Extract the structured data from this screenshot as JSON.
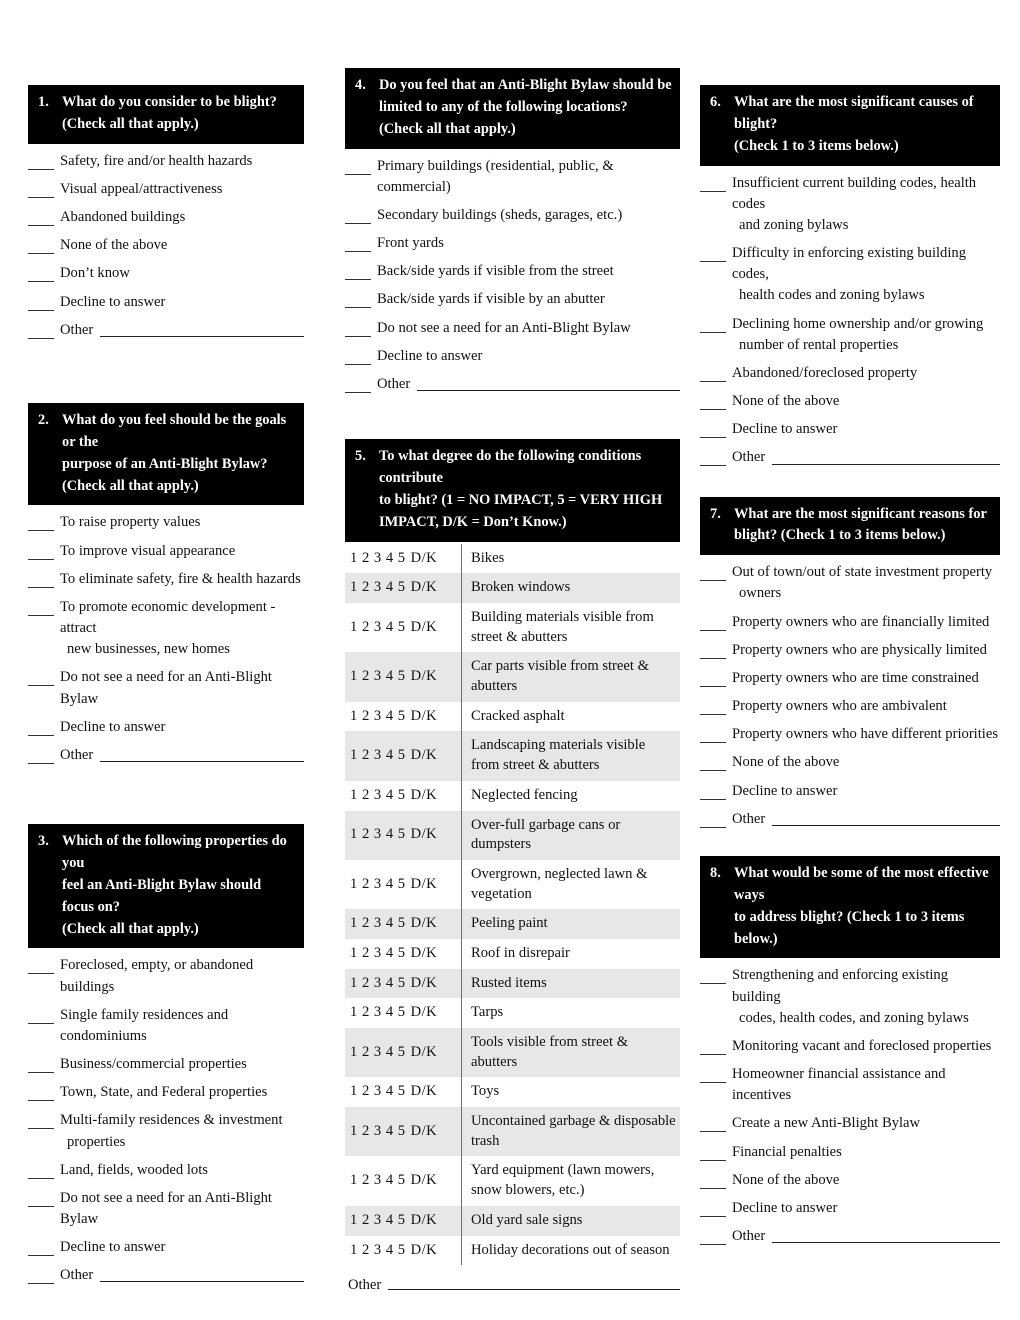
{
  "document": {
    "type": "survey-questionnaire",
    "colors": {
      "header_bar": "#000000",
      "header_text": "#ffffff",
      "row_shade": "#e7e7e7",
      "page": "#ffffff"
    }
  },
  "columns": {
    "left": [
      "q1",
      "q2",
      "q3"
    ],
    "middle": [
      "q4",
      "q5"
    ],
    "right": [
      "q6",
      "q7",
      "q8"
    ]
  },
  "questions": {
    "q1": {
      "number": "1.",
      "header_lines": [
        "What do you consider to be blight?",
        "(Check all that apply.)"
      ],
      "options": [
        {
          "lines": [
            "Safety, fire and/or health hazards"
          ]
        },
        {
          "lines": [
            "Visual appeal/attractiveness"
          ]
        },
        {
          "lines": [
            "Abandoned buildings"
          ]
        },
        {
          "lines": [
            "None of the above"
          ]
        },
        {
          "lines": [
            "Don’t know"
          ]
        },
        {
          "lines": [
            "Decline to answer"
          ]
        },
        {
          "lines": [
            "Other"
          ],
          "rule": true
        }
      ]
    },
    "q2": {
      "number": "2.",
      "header_lines": [
        "What do you feel should be the goals or the",
        "purpose of an Anti-Blight Bylaw?",
        "(Check all that apply.)"
      ],
      "options": [
        {
          "lines": [
            "To raise property values"
          ]
        },
        {
          "lines": [
            "To improve visual appearance"
          ]
        },
        {
          "lines": [
            "To eliminate safety, fire & health hazards"
          ]
        },
        {
          "lines": [
            "To promote economic development - attract",
            "new businesses, new homes"
          ]
        },
        {
          "lines": [
            "Do not see a need for an Anti-Blight Bylaw"
          ]
        },
        {
          "lines": [
            "Decline to answer"
          ]
        },
        {
          "lines": [
            "Other"
          ],
          "rule": true
        }
      ]
    },
    "q3": {
      "number": "3.",
      "header_lines": [
        "Which of the following properties do you",
        "feel an Anti-Blight Bylaw should focus on?",
        "(Check all that apply.)"
      ],
      "options": [
        {
          "lines": [
            "Foreclosed, empty, or abandoned buildings"
          ]
        },
        {
          "lines": [
            "Single family residences and condominiums"
          ]
        },
        {
          "lines": [
            "Business/commercial properties"
          ]
        },
        {
          "lines": [
            "Town, State, and Federal properties"
          ]
        },
        {
          "lines": [
            "Multi-family residences & investment",
            "properties"
          ]
        },
        {
          "lines": [
            "Land, fields, wooded lots"
          ]
        },
        {
          "lines": [
            "Do not see a need for an Anti-Blight Bylaw"
          ]
        },
        {
          "lines": [
            "Decline to answer"
          ]
        },
        {
          "lines": [
            "Other"
          ],
          "rule": true
        }
      ]
    },
    "q4": {
      "number": "4.",
      "header_lines": [
        "Do you feel that an Anti-Blight Bylaw should be",
        "limited to any of the following locations?",
        "(Check all that apply.)"
      ],
      "options": [
        {
          "lines": [
            "Primary buildings (residential, public, & commercial)"
          ]
        },
        {
          "lines": [
            "Secondary buildings (sheds, garages, etc.)"
          ]
        },
        {
          "lines": [
            "Front yards"
          ]
        },
        {
          "lines": [
            "Back/side yards if visible from the street"
          ]
        },
        {
          "lines": [
            "Back/side yards if visible by an abutter"
          ]
        },
        {
          "lines": [
            "Do not see a need for an Anti-Blight Bylaw"
          ]
        },
        {
          "lines": [
            "Decline to answer"
          ]
        },
        {
          "lines": [
            "Other"
          ],
          "rule": true
        }
      ]
    },
    "q5": {
      "number": "5.",
      "header_lines": [
        "To what degree do the following conditions contribute",
        "to blight?  (1 = NO  IMPACT, 5 = VERY HIGH",
        "IMPACT, D/K = Don’t Know.)"
      ],
      "scale_digits": "1  2  3  4  5",
      "scale_dk": "D/K",
      "items": [
        "Bikes",
        "Broken windows",
        "Building materials visible from street & abutters",
        "Car parts visible from street & abutters",
        "Cracked asphalt",
        "Landscaping materials visible from street & abutters",
        "Neglected fencing",
        "Over-full garbage cans or dumpsters",
        "Overgrown, neglected lawn & vegetation",
        "Peeling paint",
        "Roof in disrepair",
        "Rusted items",
        "Tarps",
        "Tools visible from street & abutters",
        "Toys",
        "Uncontained garbage & disposable trash",
        "Yard equipment (lawn mowers, snow blowers, etc.)",
        "Old yard sale signs",
        "Holiday decorations out of season"
      ],
      "other_label": "Other"
    },
    "q6": {
      "number": "6.",
      "header_lines": [
        "What are the most significant causes of blight?",
        "(Check 1 to 3 items below.)"
      ],
      "options": [
        {
          "lines": [
            "Insufficient current building codes, health codes",
            "and zoning bylaws"
          ]
        },
        {
          "lines": [
            "Difficulty in enforcing existing building codes,",
            "health codes and zoning bylaws"
          ]
        },
        {
          "lines": [
            "Declining home ownership and/or growing",
            "number of rental properties"
          ]
        },
        {
          "lines": [
            "Abandoned/foreclosed property"
          ]
        },
        {
          "lines": [
            "None of the above"
          ]
        },
        {
          "lines": [
            "Decline to answer"
          ]
        },
        {
          "lines": [
            "Other"
          ],
          "rule": true
        }
      ]
    },
    "q7": {
      "number": "7.",
      "header_lines": [
        "What are the most significant reasons for",
        "blight?  (Check 1 to 3 items below.)"
      ],
      "options": [
        {
          "lines": [
            "Out of town/out of state investment property",
            "owners"
          ]
        },
        {
          "lines": [
            "Property owners who are financially limited"
          ]
        },
        {
          "lines": [
            "Property owners who are physically limited"
          ]
        },
        {
          "lines": [
            "Property owners who are time constrained"
          ]
        },
        {
          "lines": [
            "Property owners who are ambivalent"
          ]
        },
        {
          "lines": [
            "Property owners who have different priorities"
          ]
        },
        {
          "lines": [
            "None of the above"
          ]
        },
        {
          "lines": [
            "Decline to answer"
          ]
        },
        {
          "lines": [
            "Other"
          ],
          "rule": true
        }
      ]
    },
    "q8": {
      "number": "8.",
      "header_lines": [
        "What would be some of the most effective ways",
        "to address blight?  (Check 1 to 3 items below.)"
      ],
      "options": [
        {
          "lines": [
            "Strengthening and enforcing existing building",
            "codes, health codes, and zoning bylaws"
          ]
        },
        {
          "lines": [
            "Monitoring vacant and foreclosed properties"
          ]
        },
        {
          "lines": [
            "Homeowner financial assistance and incentives"
          ]
        },
        {
          "lines": [
            "Create a new Anti-Blight Bylaw"
          ]
        },
        {
          "lines": [
            "Financial penalties"
          ]
        },
        {
          "lines": [
            "None of the above"
          ]
        },
        {
          "lines": [
            "Decline to answer"
          ]
        },
        {
          "lines": [
            "Other"
          ],
          "rule": true
        }
      ]
    }
  }
}
